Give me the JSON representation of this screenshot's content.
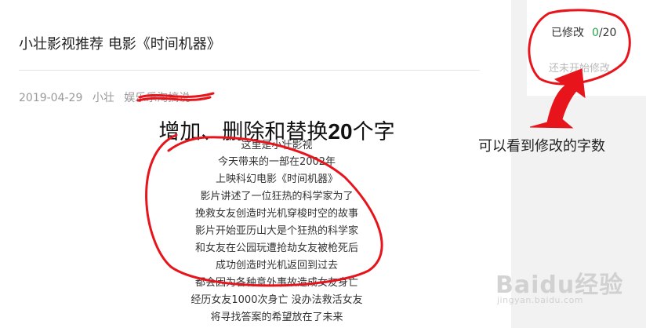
{
  "post": {
    "title": "小壮影视推荐 电影《时间机器》",
    "date": "2019-04-29",
    "author": "小壮",
    "tag": "娱乐乐淘搞说"
  },
  "content": {
    "headline_prefix": "增加、删除和替换",
    "headline_number": "20",
    "headline_suffix": "个字",
    "lines": [
      "这里是小壮影视",
      "今天带来的一部在2002年",
      "上映科幻电影《时间机器》",
      "影片讲述了一位狂热的科学家为了",
      "挽救女友创造时光机穿梭时空的故事",
      "影片开始亚历山大是个狂热的科学家",
      "和女友在公园玩遭抢劫女友被枪死后",
      "成功创造时光机返回到过去",
      "都会因为各种意外事故造成女友身亡",
      "经历女友1000次身亡 没办法救活女友",
      "将寻找答案的希望放在了未来"
    ]
  },
  "sidebar": {
    "modified_label": "已修改",
    "modified_count": "0",
    "modified_total": "/20",
    "hint": "还未开始修改"
  },
  "annotation": {
    "note": "可以看到修改的字数",
    "mark_color": "#e8141c"
  },
  "watermark": {
    "brand": "Baidu经验",
    "site": "jingyan.baidu.com"
  }
}
